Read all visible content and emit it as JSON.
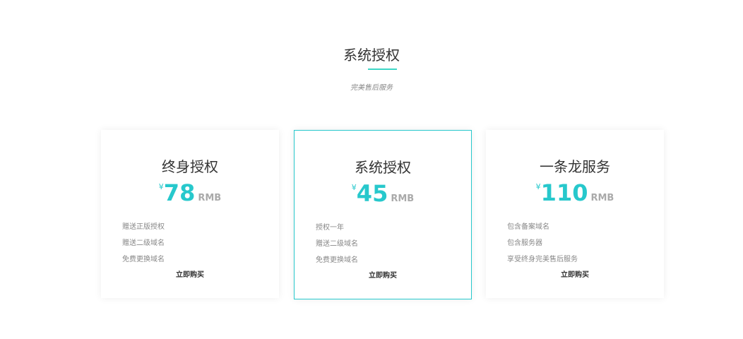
{
  "header": {
    "title": "系统授权",
    "subtitle": "完美售后服务"
  },
  "cards": [
    {
      "title": "终身授权",
      "currency": "¥",
      "price": "78",
      "unit": "RMB",
      "features": [
        "赠送正版授权",
        "赠送二级域名",
        "免费更换域名"
      ],
      "buy": "立即购买"
    },
    {
      "title": "系统授权",
      "currency": "¥",
      "price": "45",
      "unit": "RMB",
      "features": [
        "授权一年",
        "赠送二级域名",
        "免费更换域名"
      ],
      "buy": "立即购买"
    },
    {
      "title": "一条龙服务",
      "currency": "¥",
      "price": "110",
      "unit": "RMB",
      "features": [
        "包含备案域名",
        "包含服务器",
        "享受终身完美售后服务"
      ],
      "buy": "立即购买"
    }
  ],
  "colors": {
    "accent": "#27c8cc"
  }
}
